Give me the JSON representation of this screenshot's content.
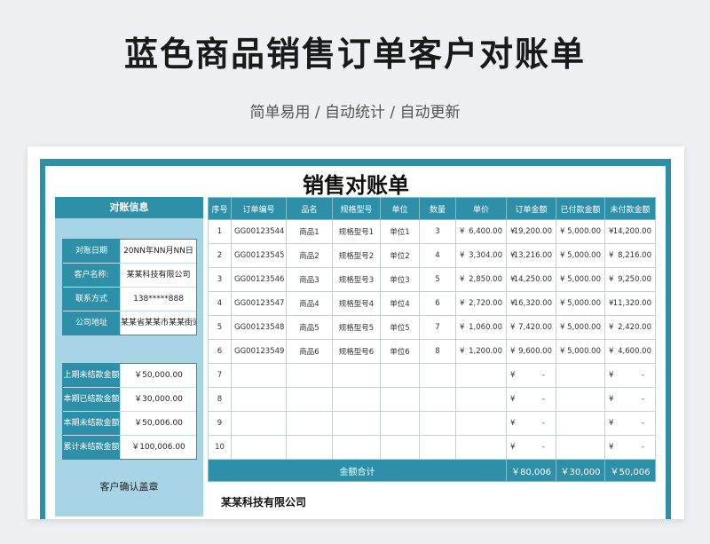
{
  "header": {
    "title": "蓝色商品销售订单客户对账单",
    "subtitle": "简单易用  /  自动统计  /  自动更新"
  },
  "doc": {
    "title": "销售对账单",
    "company": "某某科技有限公司"
  },
  "account_info": {
    "header": "对账信息",
    "rows": [
      {
        "label": "对账日期",
        "value": "20NN年NN月NN日"
      },
      {
        "label": "客户名称:",
        "value": "某某科技有限公司"
      },
      {
        "label": "联系方式",
        "value": "138*****888"
      },
      {
        "label": "公司地址",
        "value": "某某省某某市某某街道"
      }
    ],
    "balances": [
      {
        "label": "上期未结款金额",
        "value": "￥50,000.00"
      },
      {
        "label": "本期已结款金额",
        "value": "￥30,000.00"
      },
      {
        "label": "本期未结款金额",
        "value": "￥50,006.00"
      },
      {
        "label": "累计未结款金额",
        "value": "￥100,006.00"
      }
    ],
    "stamp_label": "客户确认盖章"
  },
  "table": {
    "columns": [
      "序号",
      "订单编号",
      "品名",
      "规格型号",
      "单位",
      "数量",
      "单价",
      "订单金额",
      "已付款金额",
      "未付款金额"
    ],
    "currency_symbol": "¥",
    "rows": [
      {
        "no": "1",
        "order": "GG00123544",
        "name": "商品1",
        "spec": "规格型号1",
        "unit": "单位1",
        "qty": "3",
        "price": "6,400.00",
        "amount": "19,200.00",
        "paid": "5,000.00",
        "unpaid": "14,200.00"
      },
      {
        "no": "2",
        "order": "GG00123545",
        "name": "商品2",
        "spec": "规格型号2",
        "unit": "单位2",
        "qty": "4",
        "price": "3,304.00",
        "amount": "13,216.00",
        "paid": "5,000.00",
        "unpaid": "8,216.00"
      },
      {
        "no": "3",
        "order": "GG00123546",
        "name": "商品3",
        "spec": "规格型号3",
        "unit": "单位3",
        "qty": "5",
        "price": "2,850.00",
        "amount": "14,250.00",
        "paid": "5,000.00",
        "unpaid": "9,250.00"
      },
      {
        "no": "4",
        "order": "GG00123547",
        "name": "商品4",
        "spec": "规格型号4",
        "unit": "单位4",
        "qty": "6",
        "price": "2,720.00",
        "amount": "16,320.00",
        "paid": "5,000.00",
        "unpaid": "11,320.00"
      },
      {
        "no": "5",
        "order": "GG00123548",
        "name": "商品5",
        "spec": "规格型号5",
        "unit": "单位5",
        "qty": "7",
        "price": "1,060.00",
        "amount": "7,420.00",
        "paid": "5,000.00",
        "unpaid": "2,420.00"
      },
      {
        "no": "6",
        "order": "GG00123549",
        "name": "商品6",
        "spec": "规格型号6",
        "unit": "单位6",
        "qty": "8",
        "price": "1,200.00",
        "amount": "9,600.00",
        "paid": "5,000.00",
        "unpaid": "4,600.00"
      },
      {
        "no": "7",
        "order": "",
        "name": "",
        "spec": "",
        "unit": "",
        "qty": "",
        "price": "",
        "amount": "-",
        "paid": "",
        "unpaid": "-"
      },
      {
        "no": "8",
        "order": "",
        "name": "",
        "spec": "",
        "unit": "",
        "qty": "",
        "price": "",
        "amount": "-",
        "paid": "",
        "unpaid": "-"
      },
      {
        "no": "9",
        "order": "",
        "name": "",
        "spec": "",
        "unit": "",
        "qty": "",
        "price": "",
        "amount": "-",
        "paid": "",
        "unpaid": "-"
      },
      {
        "no": "10",
        "order": "",
        "name": "",
        "spec": "",
        "unit": "",
        "qty": "",
        "price": "",
        "amount": "-",
        "paid": "",
        "unpaid": "-"
      }
    ],
    "total": {
      "label": "金额合计",
      "amount": "￥80,006",
      "paid": "￥30,000",
      "unpaid": "￥50,006"
    }
  },
  "colors": {
    "accent": "#2e8fa8",
    "panel": "#a8d5e6"
  }
}
